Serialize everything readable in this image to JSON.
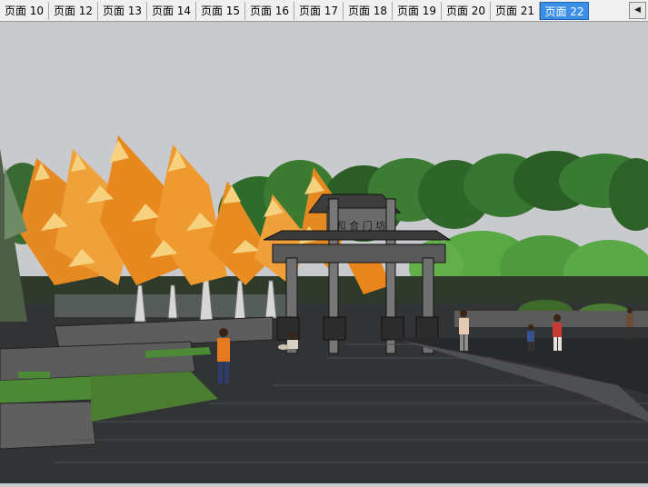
{
  "tabs": [
    {
      "label": "页面 10",
      "active": false
    },
    {
      "label": "页面 12",
      "active": false
    },
    {
      "label": "页面 13",
      "active": false
    },
    {
      "label": "页面 14",
      "active": false
    },
    {
      "label": "页面 15",
      "active": false
    },
    {
      "label": "页面 16",
      "active": false
    },
    {
      "label": "页面 17",
      "active": false
    },
    {
      "label": "页面 18",
      "active": false
    },
    {
      "label": "页面 19",
      "active": false
    },
    {
      "label": "页面 20",
      "active": false
    },
    {
      "label": "页面 21",
      "active": false
    },
    {
      "label": "页面 22",
      "active": true
    }
  ],
  "scroll_arrow_icon": "scroll-left-icon",
  "scene": {
    "archway_plaque": "和 合 门 坊",
    "colors": {
      "sky": "#c9cacd",
      "paving": "#3a3b3d",
      "lawn": "#4c7b33",
      "autumn_orange": "#e58a22",
      "autumn_yellow": "#f7d27e",
      "active_tab": "#3b8fe6"
    }
  }
}
